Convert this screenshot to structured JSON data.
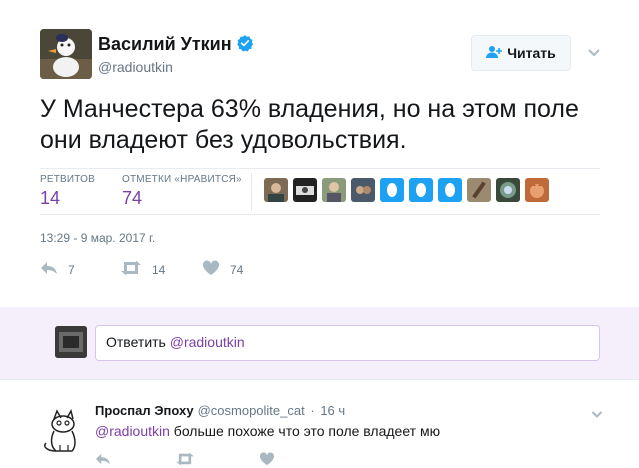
{
  "tweet": {
    "display_name": "Василий Уткин",
    "screen_name": "@radioutkin",
    "follow_label": "Читать",
    "text": "У Манчестера 63% владения, но на этом поле они владеют без удовольствия.",
    "stats": {
      "retweets_label": "РЕТВИТОВ",
      "retweets_count": "14",
      "likes_label": "ОТМЕТКИ «НРАВИТСЯ»",
      "likes_count": "74"
    },
    "timestamp": "13:29 - 9 мар. 2017 г.",
    "actions": {
      "reply_count": "7",
      "retweet_count": "14",
      "like_count": "74"
    }
  },
  "reply_box": {
    "placeholder_prefix": "Ответить ",
    "placeholder_mention": "@radioutkin"
  },
  "reply_tweet": {
    "display_name": "Проспал Эпоху",
    "screen_name": "@cosmopolite_cat",
    "separator": "·",
    "time": "16 ч",
    "mention": "@radioutkin",
    "text": " больше похоже что это поле владеет мю"
  },
  "colors": {
    "accent": "#7b3fa6",
    "verified": "#1da1f2",
    "muted": "#657786",
    "reply_bg": "#f5eefb"
  },
  "icons": [
    "person-plus-icon",
    "verified-badge-icon",
    "chevron-down-icon",
    "reply-icon",
    "retweet-icon",
    "heart-icon"
  ]
}
